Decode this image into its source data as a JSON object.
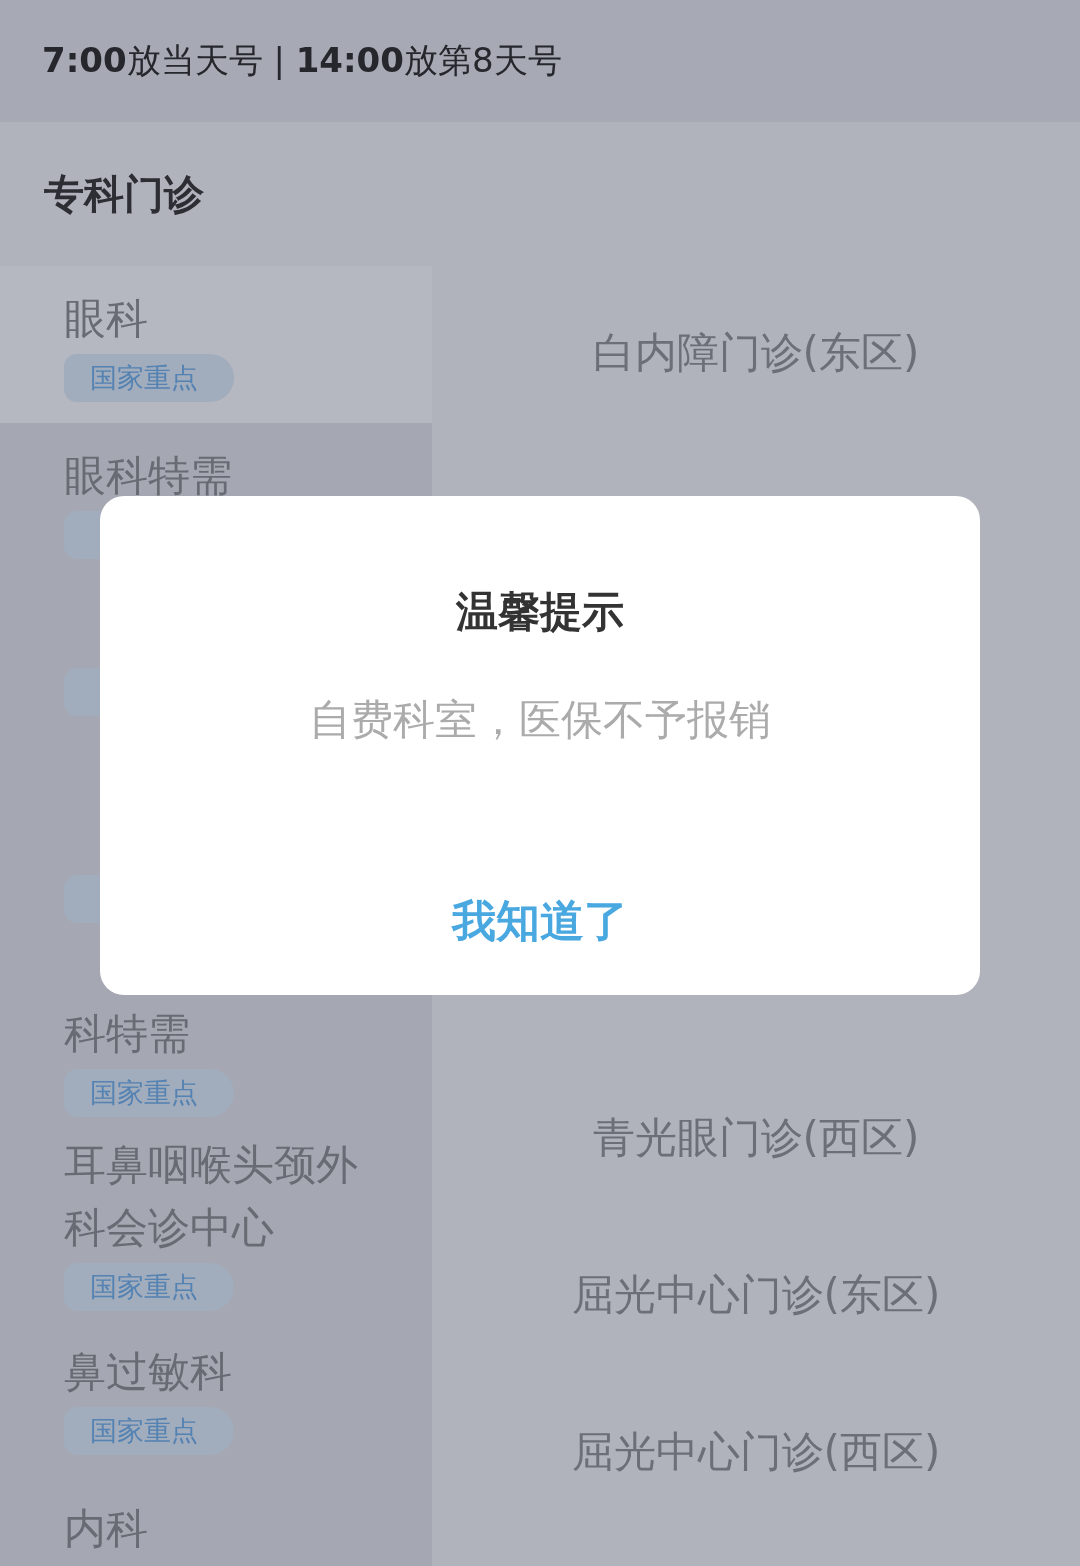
{
  "notice": "**7:00**放当天号 | **14:00**放第8天号",
  "section_title": "专科门诊",
  "departments": [
    {
      "kind": "shown",
      "name_lines": [
        "眼科"
      ],
      "tag": "国家重点",
      "selected": true
    },
    {
      "kind": "tag_covered",
      "name_lines": [
        "眼科特需"
      ],
      "selected": false
    },
    {
      "kind": "covered_one_line",
      "selected": false
    },
    {
      "kind": "covered_two_lines",
      "selected": false
    },
    {
      "kind": "first_line_covered",
      "name_lines": [
        "科特需"
      ],
      "tag": "国家重点",
      "selected": false
    },
    {
      "kind": "shown",
      "name_lines": [
        "耳鼻咽喉头颈外",
        "科会诊中心"
      ],
      "tag": "国家重点",
      "selected": false
    },
    {
      "kind": "shown",
      "name_lines": [
        "鼻过敏科"
      ],
      "tag": "国家重点",
      "selected": false
    },
    {
      "kind": "shown",
      "name_lines": [
        "内科"
      ],
      "selected": false
    }
  ],
  "clinics": [
    {
      "kind": "shown",
      "name": "白内障门诊(东区)"
    },
    {
      "kind": "covered"
    },
    {
      "kind": "covered"
    },
    {
      "kind": "covered"
    },
    {
      "kind": "covered"
    },
    {
      "kind": "shown",
      "name": "青光眼门诊(西区)"
    },
    {
      "kind": "shown",
      "name": "屈光中心门诊(东区)"
    },
    {
      "kind": "shown",
      "name": "屈光中心门诊(西区)"
    }
  ],
  "dialog": {
    "title": "温馨提示",
    "message": "自费科室，医保不予报销",
    "button": "我知道了"
  }
}
